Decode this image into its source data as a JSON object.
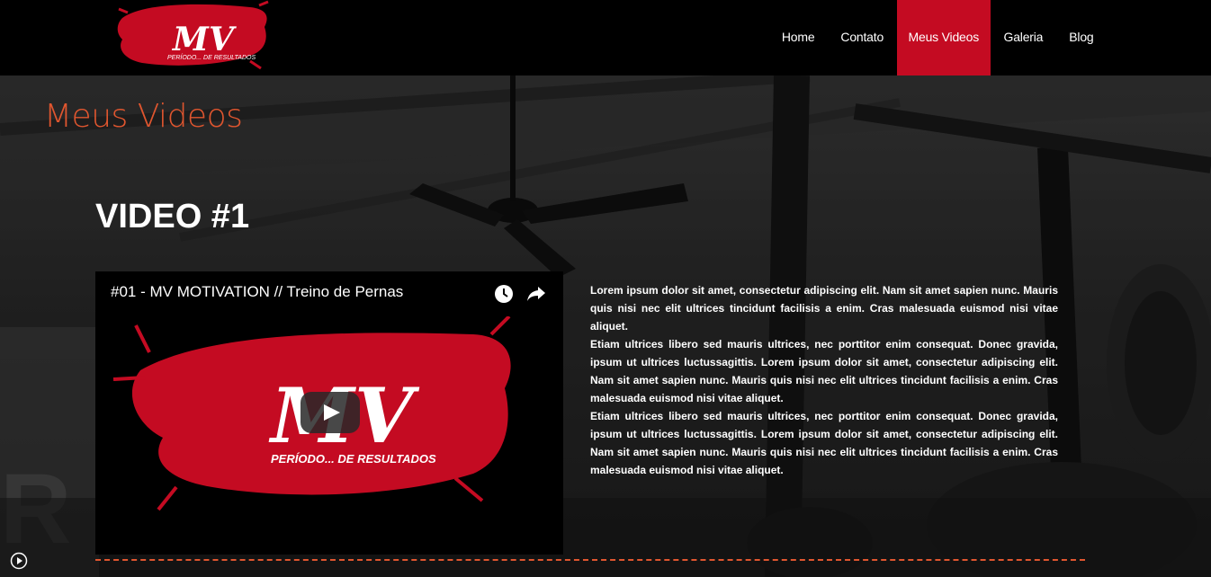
{
  "header": {
    "logo": {
      "letters": "MV",
      "tagline": "PERÍODO... DE RESULTADOS",
      "accent": "#c40b22"
    },
    "nav": [
      {
        "label": "Home",
        "active": false
      },
      {
        "label": "Contato",
        "active": false
      },
      {
        "label": "Meus Videos",
        "active": true
      },
      {
        "label": "Galeria",
        "active": false
      },
      {
        "label": "Blog",
        "active": false
      }
    ]
  },
  "page": {
    "title": "Meus Videos",
    "title_color": "#e0562f"
  },
  "video": {
    "heading": "VIDEO #1",
    "title": "#01 - MV MOTIVATION // Treino de Pernas",
    "art_letters": "MV",
    "art_tagline": "PERÍODO... DE RESULTADOS",
    "icons": [
      "clock-icon",
      "share-icon",
      "play-icon"
    ]
  },
  "description": {
    "paragraphs": [
      "Lorem ipsum dolor sit amet, consectetur adipiscing elit. Nam sit amet sapien nunc. Mauris quis nisi nec elit ultrices tincidunt facilisis a enim. Cras malesuada euismod nisi vitae aliquet.",
      "Etiam ultrices libero sed mauris ultrices, nec porttitor enim consequat. Donec gravida, ipsum ut ultrices luctussagittis. Lorem ipsum dolor sit amet, consectetur adipiscing elit. Nam sit amet sapien nunc. Mauris quis nisi nec elit ultrices tincidunt facilisis a enim. Cras malesuada euismod nisi vitae aliquet.",
      "Etiam ultrices libero sed mauris ultrices, nec porttitor enim consequat. Donec gravida, ipsum ut ultrices luctussagittis. Lorem ipsum dolor sit amet, consectetur adipiscing elit. Nam sit amet sapien nunc. Mauris quis nisi nec elit ultrices tincidunt facilisis a enim. Cras malesuada euismod nisi vitae aliquet."
    ]
  }
}
